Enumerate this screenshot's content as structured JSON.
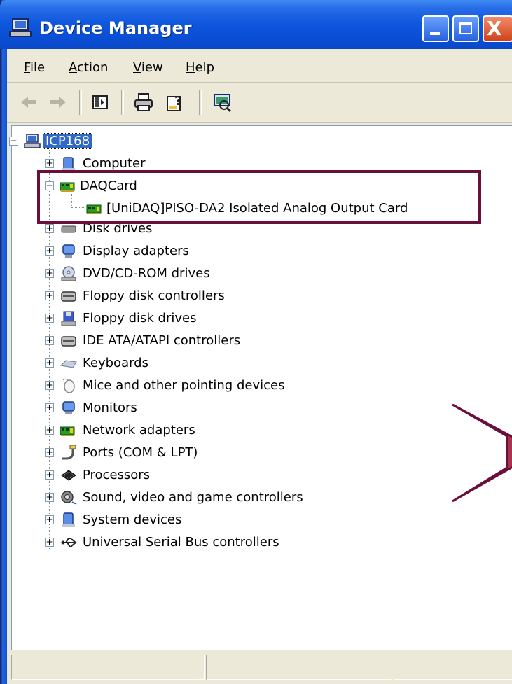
{
  "window": {
    "title": "Device Manager",
    "controls": {
      "minimize": "_",
      "maximize": "□",
      "close": "X"
    }
  },
  "menu": {
    "items": [
      {
        "label": "File",
        "underline": "F",
        "rest": "ile"
      },
      {
        "label": "Action",
        "underline": "A",
        "rest": "ction"
      },
      {
        "label": "View",
        "underline": "V",
        "rest": "iew"
      },
      {
        "label": "Help",
        "underline": "H",
        "rest": "elp"
      }
    ]
  },
  "toolbar": {
    "buttons": [
      "back-icon",
      "forward-icon",
      "show-hide-tree-icon",
      "print-icon",
      "help-icon",
      "scan-hardware-icon"
    ]
  },
  "tree": {
    "root": "ICP168",
    "nodes": [
      {
        "label": "Computer",
        "icon": "computer-icon",
        "expander": "+"
      },
      {
        "label": "DAQCard",
        "icon": "daq-card-icon",
        "expander": "−"
      },
      {
        "label": "[UniDAQ]PISO-DA2 Isolated Analog Output Card",
        "icon": "daq-card-icon",
        "expander": ""
      },
      {
        "label": "Disk drives",
        "icon": "disk-drive-icon",
        "expander": "+"
      },
      {
        "label": "Display adapters",
        "icon": "display-adapter-icon",
        "expander": "+"
      },
      {
        "label": "DVD/CD-ROM drives",
        "icon": "dvd-drive-icon",
        "expander": "+"
      },
      {
        "label": "Floppy disk controllers",
        "icon": "floppy-controller-icon",
        "expander": "+"
      },
      {
        "label": "Floppy disk drives",
        "icon": "floppy-drive-icon",
        "expander": "+"
      },
      {
        "label": "IDE ATA/ATAPI controllers",
        "icon": "ide-controller-icon",
        "expander": "+"
      },
      {
        "label": "Keyboards",
        "icon": "keyboard-icon",
        "expander": "+"
      },
      {
        "label": "Mice and other pointing devices",
        "icon": "mouse-icon",
        "expander": "+"
      },
      {
        "label": "Monitors",
        "icon": "monitor-icon",
        "expander": "+"
      },
      {
        "label": "Network adapters",
        "icon": "network-adapter-icon",
        "expander": "+"
      },
      {
        "label": "Ports (COM & LPT)",
        "icon": "port-icon",
        "expander": "+"
      },
      {
        "label": "Processors",
        "icon": "processor-icon",
        "expander": "+"
      },
      {
        "label": "Sound, video and game controllers",
        "icon": "sound-icon",
        "expander": "+"
      },
      {
        "label": "System devices",
        "icon": "system-device-icon",
        "expander": "+"
      },
      {
        "label": "Universal Serial Bus controllers",
        "icon": "usb-icon",
        "expander": "+"
      }
    ]
  },
  "colors": {
    "highlight_border": "#6b0f3a",
    "callout_fill": "#a8334e",
    "selection": "#316ac5",
    "titlebar": "#0a4fd6"
  }
}
